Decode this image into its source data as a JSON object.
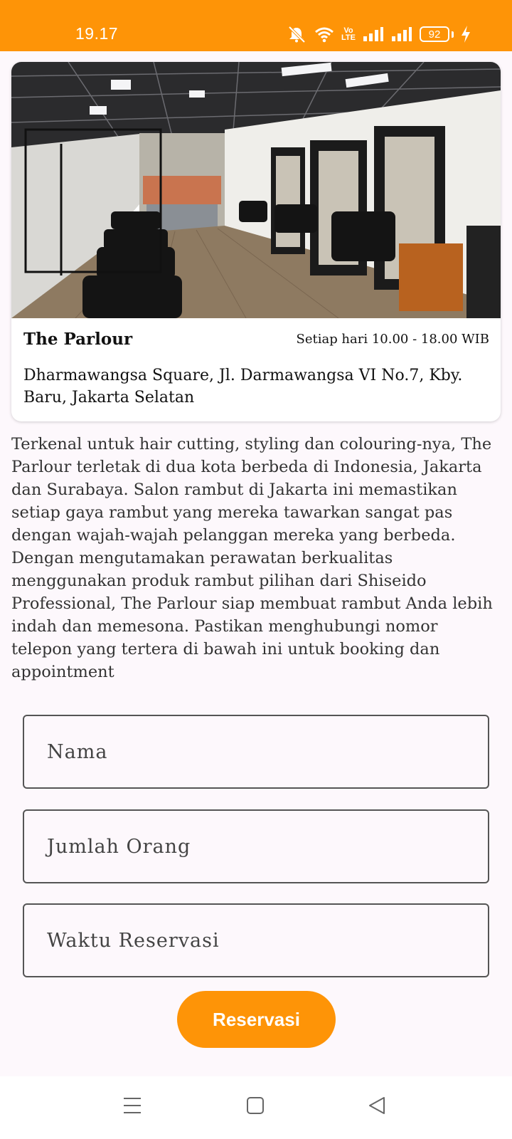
{
  "status_bar": {
    "time": "19.17",
    "battery": "92",
    "volte_label": "Vo LTE"
  },
  "venue": {
    "name": "The Parlour",
    "hours": "Setiap hari 10.00 - 18.00 WIB",
    "address": "Dharmawangsa Square, Jl. Darmawangsa VI No.7, Kby. Baru, Jakarta Selatan",
    "description": "Terkenal untuk hair cutting, styling dan colouring-nya, The Parlour terletak di dua kota berbeda di Indonesia, Jakarta dan Surabaya. Salon rambut di Jakarta ini memastikan setiap gaya rambut yang mereka tawarkan sangat pas dengan wajah-wajah pelanggan mereka yang berbeda. Dengan mengutamakan perawatan berkualitas menggunakan produk rambut pilihan dari Shiseido Professional, The Parlour siap membuat rambut Anda lebih indah dan memesona. Pastikan menghubungi nomor telepon yang tertera di bawah ini untuk booking dan appointment"
  },
  "form": {
    "name_placeholder": "Nama",
    "people_placeholder": "Jumlah Orang",
    "time_placeholder": "Waktu Reservasi",
    "submit_label": "Reservasi"
  },
  "colors": {
    "accent": "#fe9407",
    "background": "#fdf8fc"
  },
  "icons": {
    "status": [
      "mute-icon",
      "wifi-icon",
      "volte-icon",
      "signal-icon",
      "signal-icon",
      "battery-icon",
      "charging-icon"
    ],
    "nav": [
      "menu-icon",
      "home-icon",
      "back-icon"
    ]
  }
}
